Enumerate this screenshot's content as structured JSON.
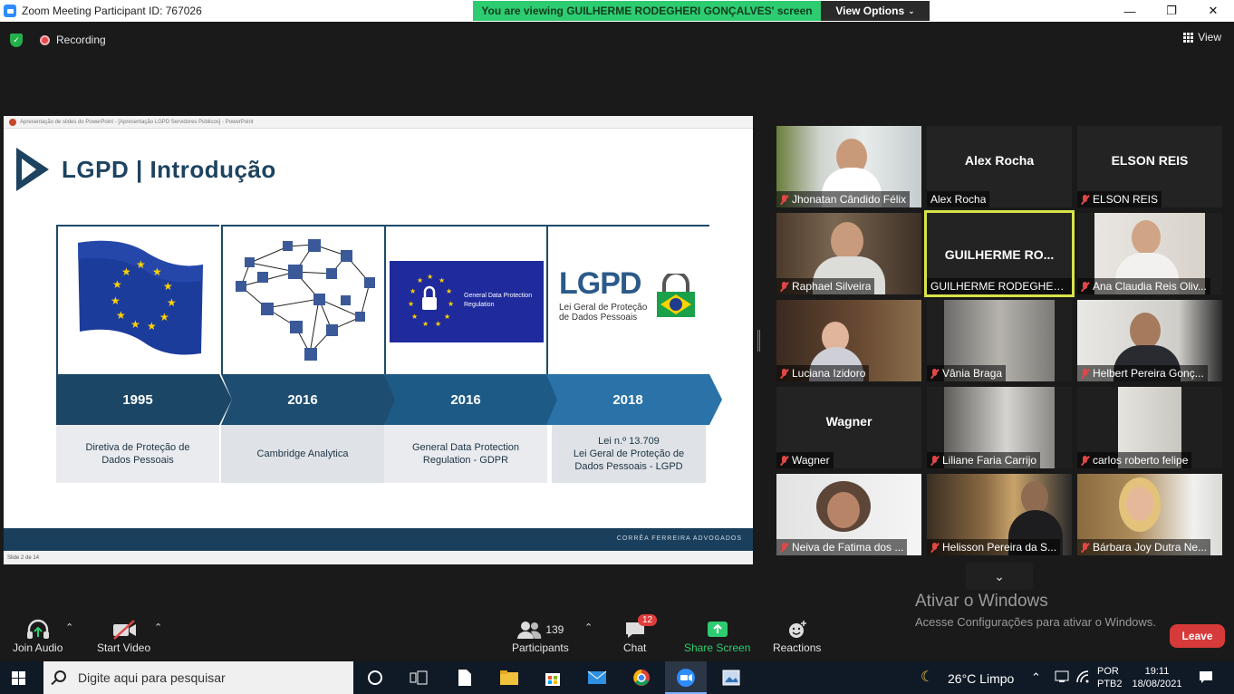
{
  "titlebar": {
    "title": "Zoom Meeting Participant ID: 767026",
    "share_banner": "You are viewing GUILHERME RODEGHERI GONÇALVES' screen",
    "view_options": "View Options",
    "minimize": "—",
    "maximize": "❐",
    "close": "✕"
  },
  "meeting": {
    "recording": "Recording",
    "view": "View"
  },
  "ppt": {
    "window_title": "Apresentação de slides do PowerPoint - [Apresentação LGPD Servidores Públicos] - PowerPoint",
    "status": "Slide 2 de 14"
  },
  "slide": {
    "title": "LGPD | Introdução",
    "footer": "CORRÊA FERREIRA ADVOGADOS",
    "gdpr_badge": "General Data Protection Regulation",
    "lgpd_logo": "LGPD",
    "lgpd_logo_sub": "Lei Geral de Proteção de Dados Pessoais",
    "timeline": [
      {
        "year": "1995",
        "line1": "Diretiva de Proteção de",
        "line2": "Dados Pessoais",
        "line3": ""
      },
      {
        "year": "2016",
        "line1": "Cambridge Analytica",
        "line2": "",
        "line3": ""
      },
      {
        "year": "2016",
        "line1": "General Data Protection",
        "line2": "Regulation - GDPR",
        "line3": ""
      },
      {
        "year": "2018",
        "line1": "Lei n.º 13.709",
        "line2": "Lei Geral de Proteção de",
        "line3": "Dados Pessoais - LGPD"
      }
    ]
  },
  "participants": [
    {
      "name": "Jhonatan Cândido Félix",
      "big": "",
      "muted": true
    },
    {
      "name": "Alex Rocha",
      "big": "Alex Rocha",
      "muted": false
    },
    {
      "name": "ELSON REIS",
      "big": "ELSON REIS",
      "muted": true
    },
    {
      "name": "Raphael Silveira",
      "big": "",
      "muted": true
    },
    {
      "name": "GUILHERME RODEGHERI...",
      "big": "GUILHERME RO...",
      "muted": false
    },
    {
      "name": "Ana Claudia Reis Oliv...",
      "big": "",
      "muted": true
    },
    {
      "name": "Luciana Izidoro",
      "big": "",
      "muted": true
    },
    {
      "name": "Vânia Braga",
      "big": "",
      "muted": true
    },
    {
      "name": "Helbert Pereira Gonç...",
      "big": "",
      "muted": true
    },
    {
      "name": "Wagner",
      "big": "Wagner",
      "muted": true
    },
    {
      "name": "Liliane Faria Carrijo",
      "big": "",
      "muted": true
    },
    {
      "name": "carlos roberto felipe",
      "big": "",
      "muted": true
    },
    {
      "name": "Neiva de Fatima dos ...",
      "big": "",
      "muted": true
    },
    {
      "name": "Helisson Pereira da S...",
      "big": "",
      "muted": true
    },
    {
      "name": "Bárbara Joy Dutra Ne...",
      "big": "",
      "muted": true
    }
  ],
  "watermark": {
    "line1": "Ativar o Windows",
    "line2": "Acesse Configurações para ativar o Windows."
  },
  "toolbar": {
    "join_audio": "Join Audio",
    "start_video": "Start Video",
    "participants": "Participants",
    "participants_count": "139",
    "chat": "Chat",
    "chat_badge": "12",
    "share_screen": "Share Screen",
    "reactions": "Reactions",
    "leave": "Leave"
  },
  "taskbar": {
    "search_placeholder": "Digite aqui para pesquisar",
    "weather": "26°C  Limpo",
    "lang1": "POR",
    "lang2": "PTB2",
    "time": "19:11",
    "date": "18/08/2021"
  },
  "colors": {
    "share_banner": "#2ecc71",
    "slide_blue": "#1d4360",
    "leave": "#d73a3a",
    "active_speaker": "#d8e34a"
  }
}
